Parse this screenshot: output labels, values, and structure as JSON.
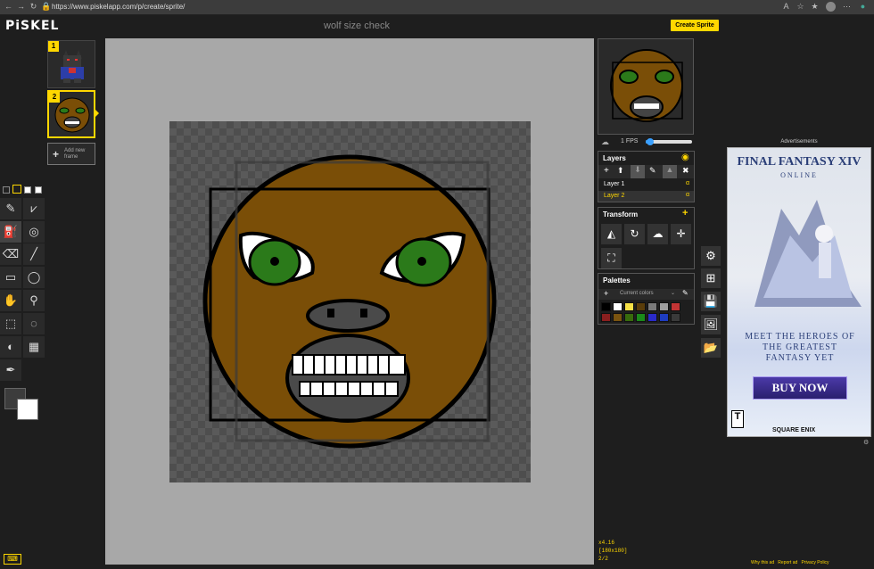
{
  "browser": {
    "url": "https://www.piskelapp.com/p/create/sprite/"
  },
  "app": {
    "logo": "PiSKEL",
    "title": "wolf size check",
    "create_label": "Create Sprite"
  },
  "frames": [
    {
      "number": "1"
    },
    {
      "number": "2"
    }
  ],
  "add_frame_label": "Add new frame",
  "preview": {
    "fps_label": "1 FPS",
    "fps_value": 0.05
  },
  "layers": {
    "title": "Layers",
    "items": [
      {
        "name": "Layer 1",
        "alpha": "α"
      },
      {
        "name": "Layer 2",
        "alpha": "α"
      }
    ]
  },
  "transform": {
    "title": "Transform"
  },
  "palettes": {
    "title": "Palettes",
    "selected": "Current colors",
    "colors": [
      "#000000",
      "#ffffff",
      "#f5e046",
      "#5a3d0a",
      "#7a7a7a",
      "#9f9f9f",
      "#c23434",
      "#8a1f1f",
      "#7a5410",
      "#386b0c",
      "#1a8a1a",
      "#2a2ac8",
      "#1e3cbf",
      "#3a3a3a"
    ]
  },
  "status": {
    "zoom": "x4.16",
    "size": "[180x180]",
    "frame": "2/2"
  },
  "ad": {
    "label": "Advertisements",
    "game_title": "FINAL FANTASY XIV",
    "subtitle": "ONLINE",
    "tagline": "MEET THE HEROES OF THE GREATEST FANTASY YET",
    "cta": "BUY NOW",
    "publisher": "SQUARE ENIX",
    "rating": "T",
    "links": [
      "Why this ad",
      "Report ad",
      "Privacy Policy"
    ]
  },
  "colors": {
    "accent": "#ffd700",
    "face": "#7a4e07",
    "eye": "#2b7a1a"
  }
}
